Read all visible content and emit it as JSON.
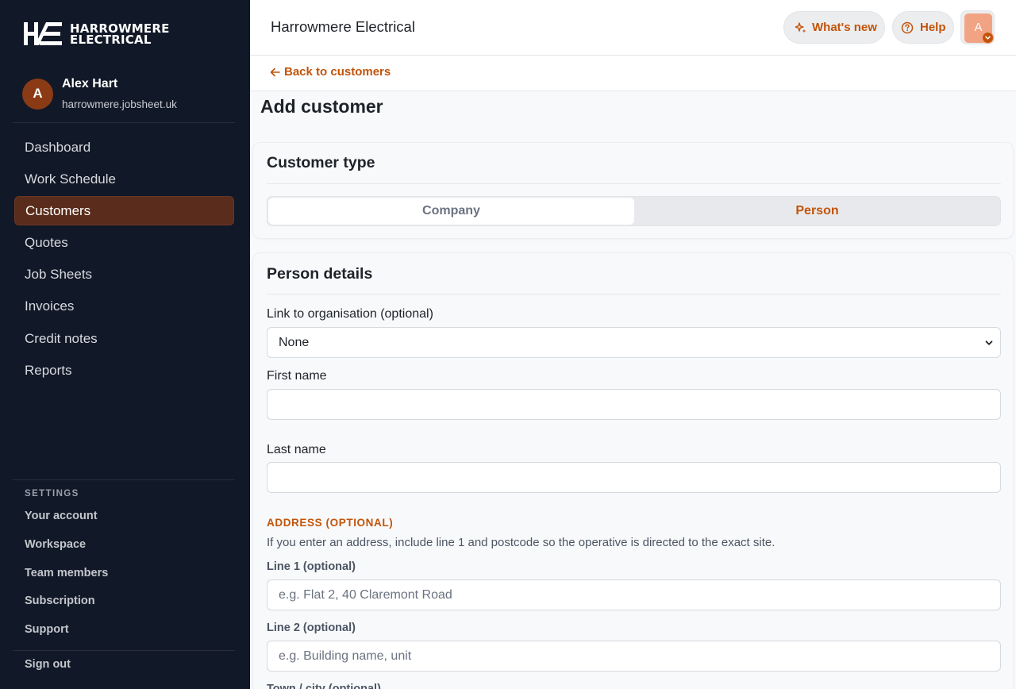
{
  "brand": {
    "line1": "HARROWMERE",
    "line2": "ELECTRICAL",
    "logo_mark": "HE monogram"
  },
  "user": {
    "initial": "A",
    "name": "Alex Hart",
    "domain": "harrowmere.jobsheet.uk"
  },
  "nav": {
    "items": [
      {
        "label": "Dashboard"
      },
      {
        "label": "Work Schedule"
      },
      {
        "label": "Customers",
        "active": true
      },
      {
        "label": "Quotes"
      },
      {
        "label": "Job Sheets"
      },
      {
        "label": "Invoices"
      },
      {
        "label": "Credit notes"
      },
      {
        "label": "Reports"
      }
    ]
  },
  "settings": {
    "heading": "SETTINGS",
    "items": [
      {
        "label": "Your account"
      },
      {
        "label": "Workspace"
      },
      {
        "label": "Team members"
      },
      {
        "label": "Subscription"
      },
      {
        "label": "Support"
      }
    ],
    "sign_out": "Sign out"
  },
  "topbar": {
    "title": "Harrowmere Electrical",
    "whats_new": "What's new",
    "help": "Help",
    "avatar_initial": "A",
    "icons": {
      "whats_new": "sparkle-icon",
      "help": "question-circle-icon",
      "avatar_badge": "chevron-down-icon"
    }
  },
  "page": {
    "back_label": "Back to customers",
    "title": "Add customer"
  },
  "customer_type": {
    "title": "Customer type",
    "options": [
      "Company",
      "Person"
    ],
    "selected": "Person"
  },
  "person_details": {
    "title": "Person details",
    "organisation": {
      "label": "Link to organisation (optional)",
      "value": "None"
    },
    "first_name": {
      "label": "First name",
      "value": ""
    },
    "last_name": {
      "label": "Last name",
      "value": ""
    },
    "address_heading": "ADDRESS (OPTIONAL)",
    "address_help": "If you enter an address, include line 1 and postcode so the operative is directed to the exact site.",
    "line1": {
      "label": "Line 1 (optional)",
      "placeholder": "e.g. Flat 2, 40 Claremont Road"
    },
    "line2": {
      "label": "Line 2 (optional)",
      "placeholder": "e.g. Building name, unit"
    },
    "town": {
      "label": "Town / city (optional)"
    }
  },
  "colors": {
    "accent": "#c2540a",
    "sidebar_bg": "#111827",
    "active_nav_bg": "#5a2c1b"
  }
}
